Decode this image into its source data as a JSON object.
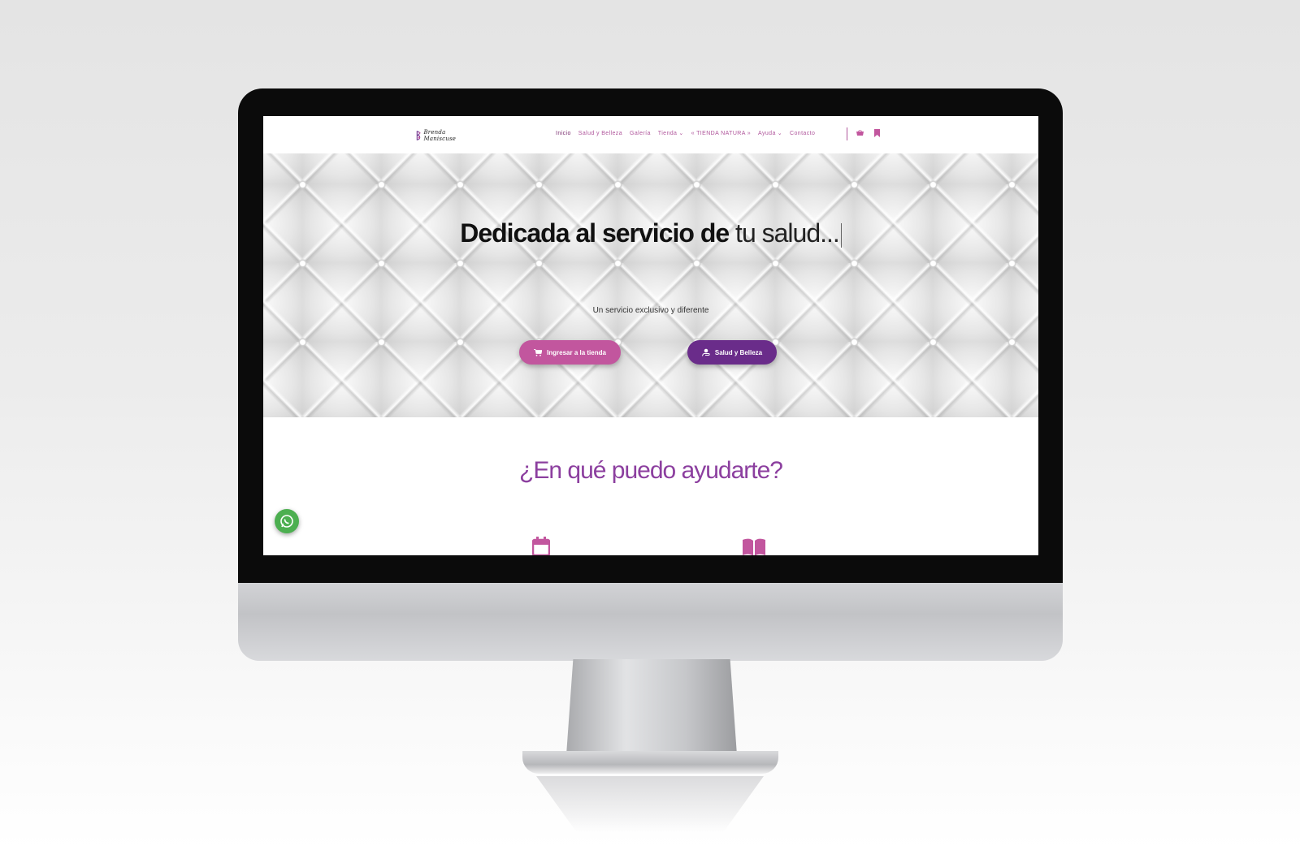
{
  "nav": {
    "logo_text": "Brenda Maniscuse",
    "items": [
      {
        "label": "Inicio",
        "dropdown": false
      },
      {
        "label": "Salud y Belleza",
        "dropdown": false
      },
      {
        "label": "Galería",
        "dropdown": false
      },
      {
        "label": "Tienda",
        "dropdown": true
      },
      {
        "label": "« TIENDA NATURA »",
        "dropdown": false
      },
      {
        "label": "Ayuda",
        "dropdown": true
      },
      {
        "label": "Contacto",
        "dropdown": false
      }
    ],
    "icons": [
      "cart-icon",
      "bookmark-icon"
    ]
  },
  "hero": {
    "title_bold": "Dedicada al servicio de",
    "title_light": " tu salud...",
    "subtitle": "Un servicio exclusivo y diferente",
    "buttons": {
      "shop_label": "Ingresar a la tienda",
      "health_label": "Salud y Belleza"
    }
  },
  "section": {
    "title": "¿En qué puedo ayudarte?"
  },
  "colors": {
    "accent_pink": "#c2569e",
    "accent_purple": "#6a2c8a",
    "heading_purple": "#8c3f9f",
    "whatsapp_green": "#4caf50"
  }
}
